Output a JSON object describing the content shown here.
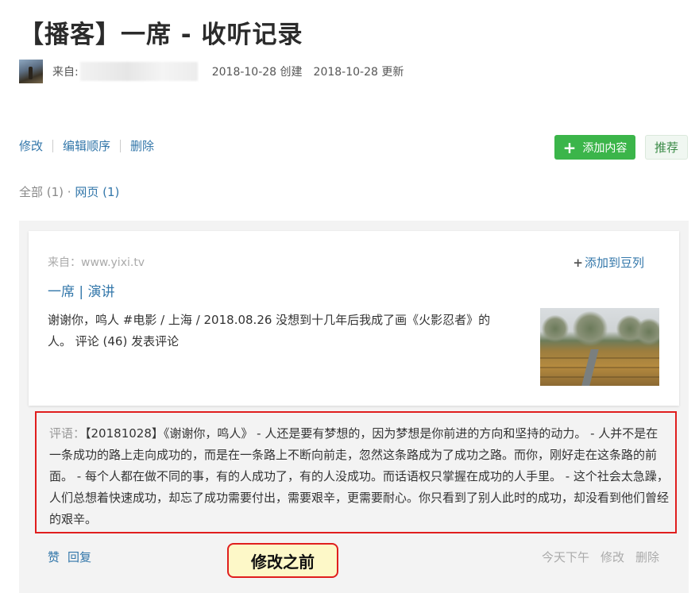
{
  "header": {
    "title": "【播客】一席 - 收听记录",
    "from_label": "来自:",
    "created": "2018-10-28 创建",
    "updated": "2018-10-28 更新"
  },
  "actions": {
    "edit": "修改",
    "reorder": "编辑顺序",
    "delete": "删除"
  },
  "buttons": {
    "add_content_icon": "+",
    "add_content": "添加内容",
    "recommend": "推荐"
  },
  "filter": {
    "all": "全部 (1) · ",
    "webpage": "网页 (1)"
  },
  "card": {
    "source": "来自：www.yixi.tv",
    "add_to_doulist_icon": "+",
    "add_to_doulist": "添加到豆列",
    "title": "一席 | 演讲",
    "description": "谢谢你，鸣人 #电影 / 上海 / 2018.08.26 没想到十几年后我成了画《火影忍者》的人。 评论 (46) 发表评论"
  },
  "comment": {
    "label": "评语：",
    "text": "【20181028】《谢谢你，鸣人》 - 人还是要有梦想的，因为梦想是你前进的方向和坚持的动力。 - 人并不是在一条成功的路上走向成功的，而是在一条路上不断向前走，忽然这条路成为了成功之路。而你，刚好走在这条路的前面。 - 每个人都在做不同的事，有的人成功了，有的人没成功。而话语权只掌握在成功的人手里。 - 这个社会太急躁，人们总想着快速成功，却忘了成功需要付出，需要艰辛，更需要耐心。你只看到了别人此时的成功，却没看到他们曾经的艰辛。"
  },
  "footer": {
    "like": "赞",
    "reply": "回复",
    "time": "今天下午",
    "edit": "修改",
    "delete": "删除"
  },
  "annotation": {
    "note": "修改之前"
  },
  "colors": {
    "link": "#3377aa",
    "add_button": "#3bb54a",
    "highlight_border": "#e01e1e",
    "note_background": "#fdf8c8"
  }
}
